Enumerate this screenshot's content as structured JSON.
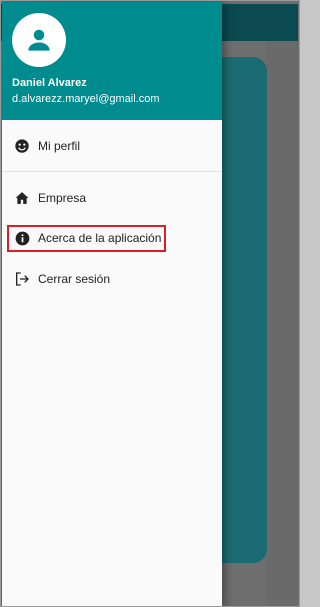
{
  "user": {
    "name": "Daniel Alvarez",
    "email": "d.alvarezz.maryel@gmail.com"
  },
  "menu": [
    {
      "label": "Mi perfil",
      "icon": "profile-face-icon"
    },
    {
      "label": "Empresa",
      "icon": "home-icon"
    },
    {
      "label": "Acerca de la aplicación",
      "icon": "info-icon",
      "highlighted": true
    },
    {
      "label": "Cerrar sesión",
      "icon": "logout-icon"
    }
  ],
  "colors": {
    "header": "#008b8e",
    "highlight_border": "#d92027",
    "drawer_bg": "#fafafa"
  }
}
